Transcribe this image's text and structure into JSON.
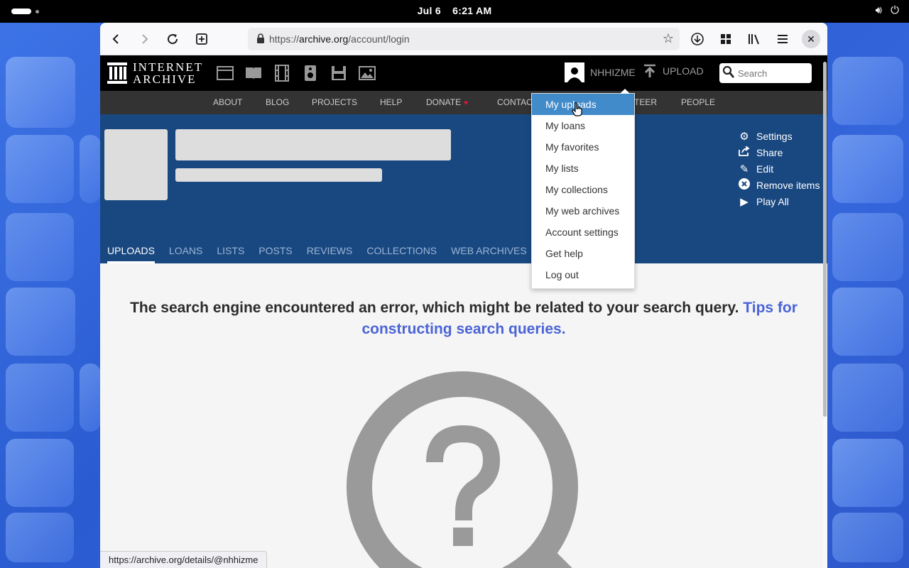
{
  "system": {
    "date": "Jul 6",
    "time": "6:21 AM"
  },
  "browser": {
    "url_prefix": "https://",
    "url_host": "archive.org",
    "url_path": "/account/login",
    "status_url": "https://archive.org/details/@nhhizme"
  },
  "ia_header": {
    "logo_line1": "INTERNET",
    "logo_line2": "ARCHIVE",
    "username": "NHHIZME",
    "upload_label": "UPLOAD",
    "search_placeholder": "Search"
  },
  "nav": {
    "items": [
      "ABOUT",
      "BLOG",
      "PROJECTS",
      "HELP",
      "DONATE",
      "CONTAC",
      "TEER",
      "PEOPLE"
    ]
  },
  "profile_actions": [
    "Settings",
    "Share",
    "Edit",
    "Remove items",
    "Play All"
  ],
  "tabs": [
    "UPLOADS",
    "LOANS",
    "LISTS",
    "POSTS",
    "REVIEWS",
    "COLLECTIONS",
    "WEB ARCHIVES"
  ],
  "active_tab": "UPLOADS",
  "error": {
    "message": "The search engine encountered an error, which might be related to your search query.",
    "link_text": "Tips for constructing search queries."
  },
  "user_menu": {
    "items": [
      "My uploads",
      "My loans",
      "My favorites",
      "My lists",
      "My collections",
      "My web archives",
      "Account settings",
      "Get help",
      "Log out"
    ],
    "highlighted": "My uploads"
  },
  "colors": {
    "banner": "#194880",
    "link": "#4b64d6",
    "menu_highlight": "#428bca"
  }
}
